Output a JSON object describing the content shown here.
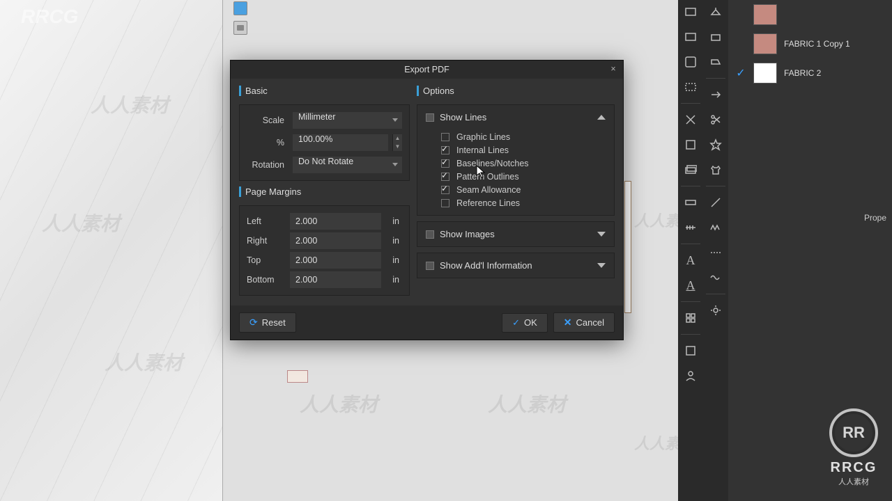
{
  "watermark_corner": "RRCG",
  "watermark_center": "人人素材",
  "watermark_logo_text": "RRCG",
  "watermark_logo_sub": "人人素材",
  "dialog": {
    "title": "Export PDF",
    "sections": {
      "basic": "Basic",
      "page_margins": "Page Margins",
      "options": "Options"
    },
    "scale_label": "Scale",
    "scale_value": "Millimeter",
    "percent_label": "%",
    "percent_value": "100.00%",
    "rotation_label": "Rotation",
    "rotation_value": "Do Not Rotate",
    "margins": {
      "left_label": "Left",
      "left_value": "2.000",
      "left_unit": "in",
      "right_label": "Right",
      "right_value": "2.000",
      "right_unit": "in",
      "top_label": "Top",
      "top_value": "2.000",
      "top_unit": "in",
      "bottom_label": "Bottom",
      "bottom_value": "2.000",
      "bottom_unit": "in"
    },
    "show_lines_label": "Show Lines",
    "show_images_label": "Show Images",
    "show_addl_label": "Show Add'l Information",
    "lines": {
      "graphic": {
        "label": "Graphic Lines",
        "checked": false
      },
      "internal": {
        "label": "Internal Lines",
        "checked": true
      },
      "baselines": {
        "label": "Baselines/Notches",
        "checked": true
      },
      "outlines": {
        "label": "Pattern Outlines",
        "checked": true
      },
      "seam": {
        "label": "Seam Allowance",
        "checked": true
      },
      "reference": {
        "label": "Reference Lines",
        "checked": false
      }
    },
    "buttons": {
      "reset": "Reset",
      "ok": "OK",
      "cancel": "Cancel"
    }
  },
  "layers": {
    "items": [
      {
        "label": "FABRIC 1 Copy 1"
      },
      {
        "label": "FABRIC 2"
      }
    ],
    "properties_label": "Prope"
  }
}
